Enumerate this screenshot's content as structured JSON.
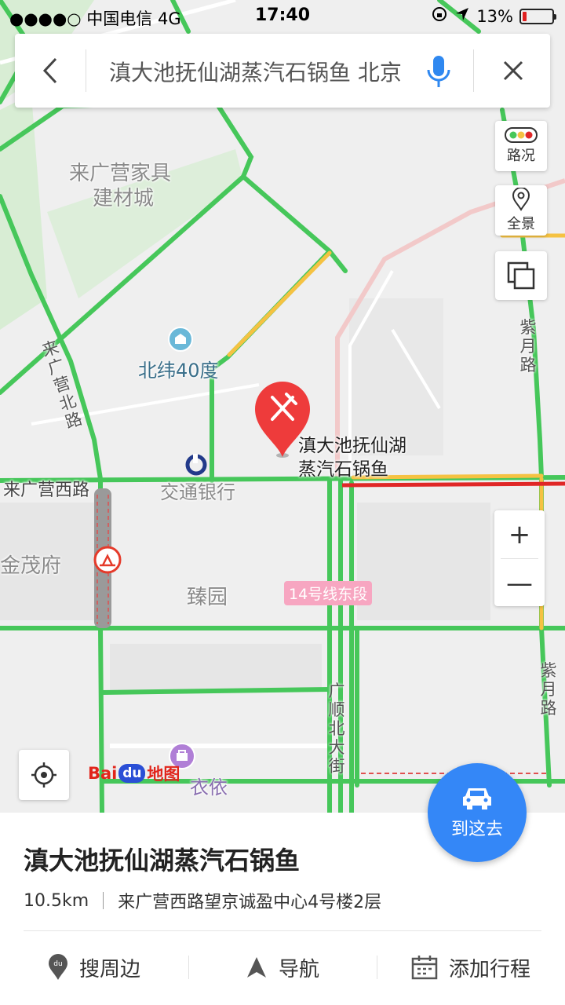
{
  "status_bar": {
    "carrier": "●●●●○ 中国电信   4G",
    "time": "17:40",
    "battery_percent": "13%",
    "battery_level": 0.13
  },
  "search": {
    "query": "滇大池抚仙湖蒸汽石锅鱼 北京"
  },
  "controls": {
    "traffic_label": "路况",
    "panorama_label": "全景",
    "zoom_in": "+",
    "zoom_out": "—"
  },
  "map": {
    "labels": {
      "laiguangying_home": "来广营家具",
      "laiguangying_home2": "建材城",
      "beiwei40": "北纬40度",
      "laiguangying_west_road": "来广营西路",
      "bank": "交通银行",
      "jinmaofu": "金茂府",
      "zhenyuan": "臻园",
      "line14": "14号线东段",
      "poi_name_line1": "滇大池抚仙湖",
      "poi_name_line2": "蒸汽石锅鱼",
      "chanyi": "衣依"
    },
    "vertical_labels": {
      "laiguangying_north_road": "来广营北路",
      "ziyue_road_top": "紫月路",
      "ziyue_road_bottom": "紫月路",
      "guangshun_north_street": "广顺北大街"
    }
  },
  "logo": {
    "text_bai": "Bai",
    "text_du": "du",
    "text_map": "地图"
  },
  "go_button": {
    "label": "到这去"
  },
  "place": {
    "name": "滇大池抚仙湖蒸汽石锅鱼",
    "distance": "10.5km",
    "address": "来广营西路望京诚盈中心4号楼2层"
  },
  "actions": [
    {
      "label": "搜周边",
      "icon": "nearby-pin-icon"
    },
    {
      "label": "导航",
      "icon": "navigation-arrow-icon"
    },
    {
      "label": "添加行程",
      "icon": "calendar-icon"
    }
  ],
  "colors": {
    "road_green": "#46c75a",
    "road_yellow": "#f5c242",
    "road_red": "#e02727",
    "accent_blue": "#3487f7",
    "marker_red": "#ee3b3b"
  }
}
